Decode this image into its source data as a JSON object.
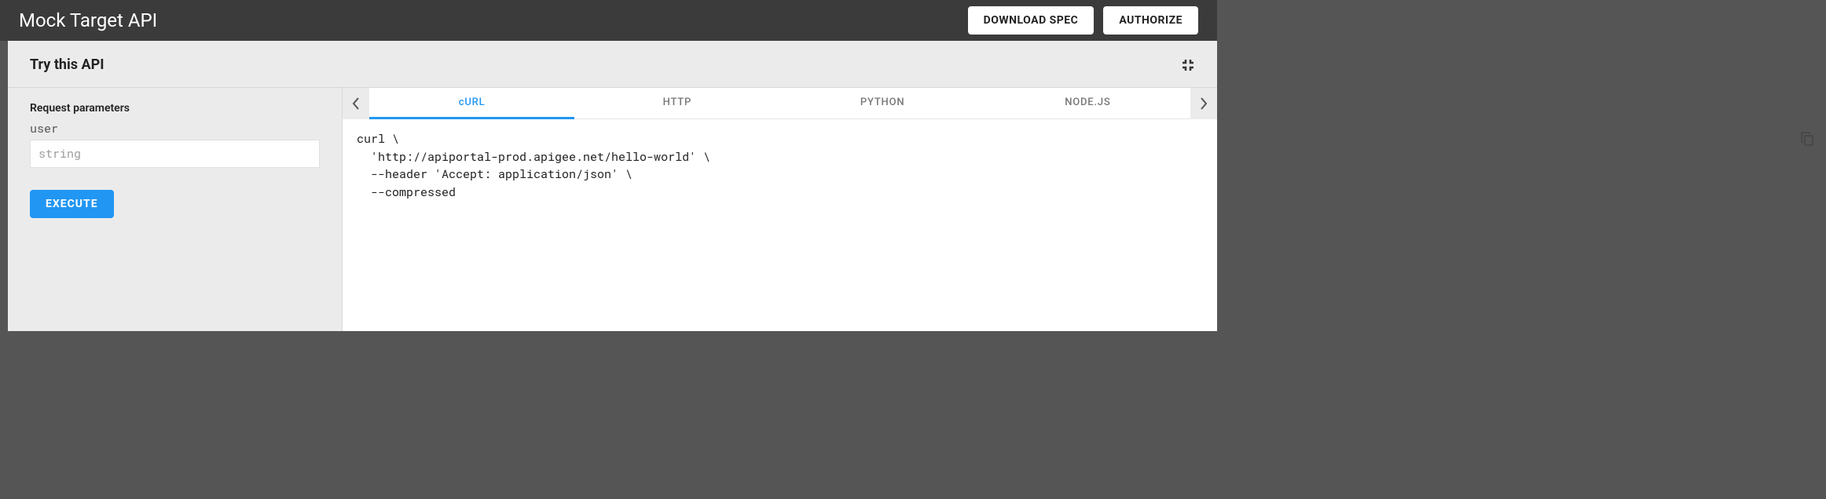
{
  "header": {
    "title": "Mock Target API",
    "download_label": "DOWNLOAD SPEC",
    "authorize_label": "AUTHORIZE"
  },
  "panel": {
    "title": "Try this API"
  },
  "params": {
    "section_label": "Request parameters",
    "items": [
      {
        "name": "user",
        "placeholder": "string"
      }
    ],
    "execute_label": "EXECUTE"
  },
  "code": {
    "tabs": [
      "cURL",
      "HTTP",
      "PYTHON",
      "NODE.JS"
    ],
    "active_index": 0,
    "snippet": "curl \\\n  'http://apiportal-prod.apigee.net/hello-world' \\\n  --header 'Accept: application/json' \\\n  --compressed"
  }
}
